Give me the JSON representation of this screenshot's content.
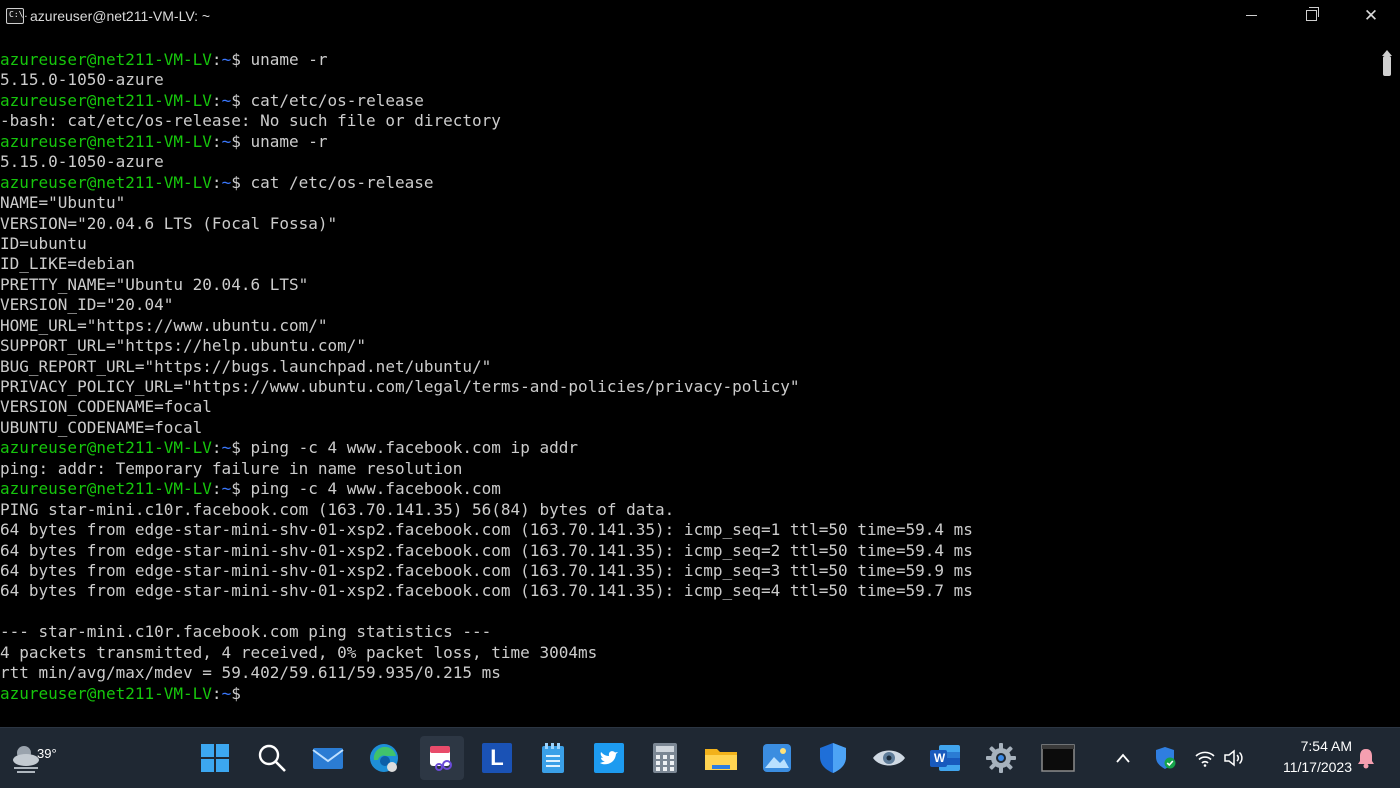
{
  "window": {
    "title": "azureuser@net211-VM-LV: ~",
    "app_icon_text": "C:\\."
  },
  "terminal": {
    "lines": [
      {
        "type": "prompt",
        "user": "azureuser@net211-VM-LV",
        "sep": ":",
        "path": "~",
        "sym": "$ ",
        "cmd": "uname -r"
      },
      {
        "type": "output",
        "text": "5.15.0-1050-azure"
      },
      {
        "type": "prompt",
        "user": "azureuser@net211-VM-LV",
        "sep": ":",
        "path": "~",
        "sym": "$ ",
        "cmd": "cat/etc/os-release"
      },
      {
        "type": "output",
        "text": "-bash: cat/etc/os-release: No such file or directory"
      },
      {
        "type": "prompt",
        "user": "azureuser@net211-VM-LV",
        "sep": ":",
        "path": "~",
        "sym": "$ ",
        "cmd": "uname -r"
      },
      {
        "type": "output",
        "text": "5.15.0-1050-azure"
      },
      {
        "type": "prompt",
        "user": "azureuser@net211-VM-LV",
        "sep": ":",
        "path": "~",
        "sym": "$ ",
        "cmd": "cat /etc/os-release"
      },
      {
        "type": "output",
        "text": "NAME=\"Ubuntu\""
      },
      {
        "type": "output",
        "text": "VERSION=\"20.04.6 LTS (Focal Fossa)\""
      },
      {
        "type": "output",
        "text": "ID=ubuntu"
      },
      {
        "type": "output",
        "text": "ID_LIKE=debian"
      },
      {
        "type": "output",
        "text": "PRETTY_NAME=\"Ubuntu 20.04.6 LTS\""
      },
      {
        "type": "output",
        "text": "VERSION_ID=\"20.04\""
      },
      {
        "type": "output",
        "text": "HOME_URL=\"https://www.ubuntu.com/\""
      },
      {
        "type": "output",
        "text": "SUPPORT_URL=\"https://help.ubuntu.com/\""
      },
      {
        "type": "output",
        "text": "BUG_REPORT_URL=\"https://bugs.launchpad.net/ubuntu/\""
      },
      {
        "type": "output",
        "text": "PRIVACY_POLICY_URL=\"https://www.ubuntu.com/legal/terms-and-policies/privacy-policy\""
      },
      {
        "type": "output",
        "text": "VERSION_CODENAME=focal"
      },
      {
        "type": "output",
        "text": "UBUNTU_CODENAME=focal"
      },
      {
        "type": "prompt",
        "user": "azureuser@net211-VM-LV",
        "sep": ":",
        "path": "~",
        "sym": "$ ",
        "cmd": "ping -c 4 www.facebook.com ip addr"
      },
      {
        "type": "output",
        "text": "ping: addr: Temporary failure in name resolution"
      },
      {
        "type": "prompt",
        "user": "azureuser@net211-VM-LV",
        "sep": ":",
        "path": "~",
        "sym": "$ ",
        "cmd": "ping -c 4 www.facebook.com"
      },
      {
        "type": "output",
        "text": "PING star-mini.c10r.facebook.com (163.70.141.35) 56(84) bytes of data."
      },
      {
        "type": "output",
        "text": "64 bytes from edge-star-mini-shv-01-xsp2.facebook.com (163.70.141.35): icmp_seq=1 ttl=50 time=59.4 ms"
      },
      {
        "type": "output",
        "text": "64 bytes from edge-star-mini-shv-01-xsp2.facebook.com (163.70.141.35): icmp_seq=2 ttl=50 time=59.4 ms"
      },
      {
        "type": "output",
        "text": "64 bytes from edge-star-mini-shv-01-xsp2.facebook.com (163.70.141.35): icmp_seq=3 ttl=50 time=59.9 ms"
      },
      {
        "type": "output",
        "text": "64 bytes from edge-star-mini-shv-01-xsp2.facebook.com (163.70.141.35): icmp_seq=4 ttl=50 time=59.7 ms"
      },
      {
        "type": "output",
        "text": ""
      },
      {
        "type": "output",
        "text": "--- star-mini.c10r.facebook.com ping statistics ---"
      },
      {
        "type": "output",
        "text": "4 packets transmitted, 4 received, 0% packet loss, time 3004ms"
      },
      {
        "type": "output",
        "text": "rtt min/avg/max/mdev = 59.402/59.611/59.935/0.215 ms"
      },
      {
        "type": "prompt",
        "user": "azureuser@net211-VM-LV",
        "sep": ":",
        "path": "~",
        "sym": "$ ",
        "cmd": ""
      }
    ]
  },
  "taskbar": {
    "weather_temp": "39°",
    "apps": [
      {
        "id": "start",
        "icon": "windows-start-icon"
      },
      {
        "id": "search",
        "icon": "search-icon"
      },
      {
        "id": "mail",
        "icon": "mail-icon"
      },
      {
        "id": "edge",
        "icon": "edge-browser-icon"
      },
      {
        "id": "snipping",
        "icon": "snipping-tool-icon",
        "active": true
      },
      {
        "id": "l-app",
        "icon": "l-app-icon",
        "label": "L"
      },
      {
        "id": "notepad",
        "icon": "notepad-icon"
      },
      {
        "id": "twitter",
        "icon": "twitter-icon"
      },
      {
        "id": "calculator",
        "icon": "calculator-icon"
      },
      {
        "id": "explorer",
        "icon": "file-explorer-icon"
      },
      {
        "id": "photos",
        "icon": "photos-icon"
      },
      {
        "id": "defender",
        "icon": "defender-shield-icon"
      },
      {
        "id": "eye",
        "icon": "eye-icon"
      },
      {
        "id": "word",
        "icon": "word-icon",
        "label": "W"
      },
      {
        "id": "settings",
        "icon": "settings-gear-icon"
      },
      {
        "id": "terminal",
        "icon": "terminal-icon"
      }
    ],
    "clock_time": "7:54 AM",
    "clock_date": "11/17/2023"
  },
  "colors": {
    "prompt_user": "#16c60c",
    "prompt_path": "#3b78ff",
    "text": "#cccccc",
    "taskbar": "#1f2833"
  }
}
